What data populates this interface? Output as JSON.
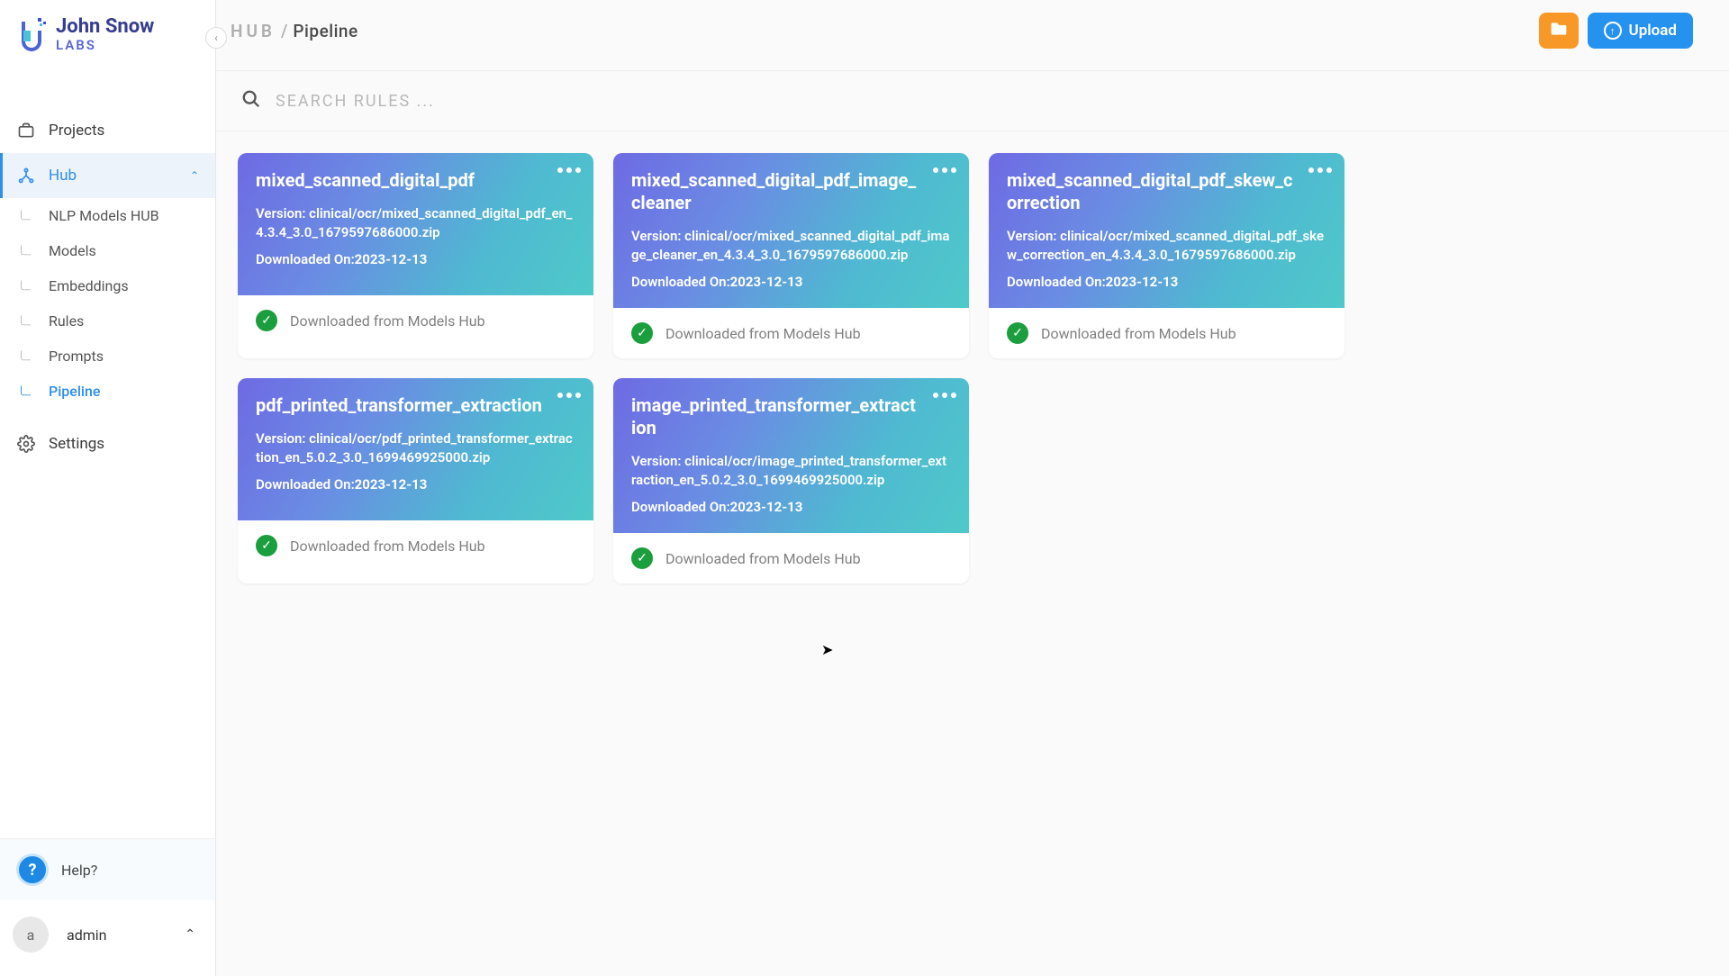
{
  "brand": {
    "name_top": "John Snow",
    "name_bottom": "LABS"
  },
  "breadcrumb": {
    "parent": "HUB",
    "current": "Pipeline"
  },
  "actions": {
    "upload_label": "Upload"
  },
  "search": {
    "placeholder": "SEARCH RULES ..."
  },
  "sidebar": {
    "projects": "Projects",
    "hub": "Hub",
    "settings": "Settings",
    "sub": {
      "nlp": "NLP Models HUB",
      "models": "Models",
      "embeddings": "Embeddings",
      "rules": "Rules",
      "prompts": "Prompts",
      "pipeline": "Pipeline"
    },
    "help": "Help?",
    "user": {
      "initial": "a",
      "name": "admin"
    }
  },
  "labels": {
    "version_prefix": "Version: ",
    "downloaded_prefix": "Downloaded On:"
  },
  "cards": [
    {
      "title": "mixed_scanned_digital_pdf",
      "version": "clinical/ocr/mixed_scanned_digital_pdf_en_4.3.4_3.0_1679597686000.zip",
      "downloaded": "2023-12-13",
      "status": "Downloaded from Models Hub"
    },
    {
      "title": "mixed_scanned_digital_pdf_image_cleaner",
      "version": "clinical/ocr/mixed_scanned_digital_pdf_image_cleaner_en_4.3.4_3.0_1679597686000.zip",
      "downloaded": "2023-12-13",
      "status": "Downloaded from Models Hub"
    },
    {
      "title": "mixed_scanned_digital_pdf_skew_correction",
      "version": "clinical/ocr/mixed_scanned_digital_pdf_skew_correction_en_4.3.4_3.0_1679597686000.zip",
      "downloaded": "2023-12-13",
      "status": "Downloaded from Models Hub"
    },
    {
      "title": "pdf_printed_transformer_extraction",
      "version": "clinical/ocr/pdf_printed_transformer_extraction_en_5.0.2_3.0_1699469925000.zip",
      "downloaded": "2023-12-13",
      "status": "Downloaded from Models Hub"
    },
    {
      "title": "image_printed_transformer_extraction",
      "version": "clinical/ocr/image_printed_transformer_extraction_en_5.0.2_3.0_1699469925000.zip",
      "downloaded": "2023-12-13",
      "status": "Downloaded from Models Hub"
    }
  ]
}
